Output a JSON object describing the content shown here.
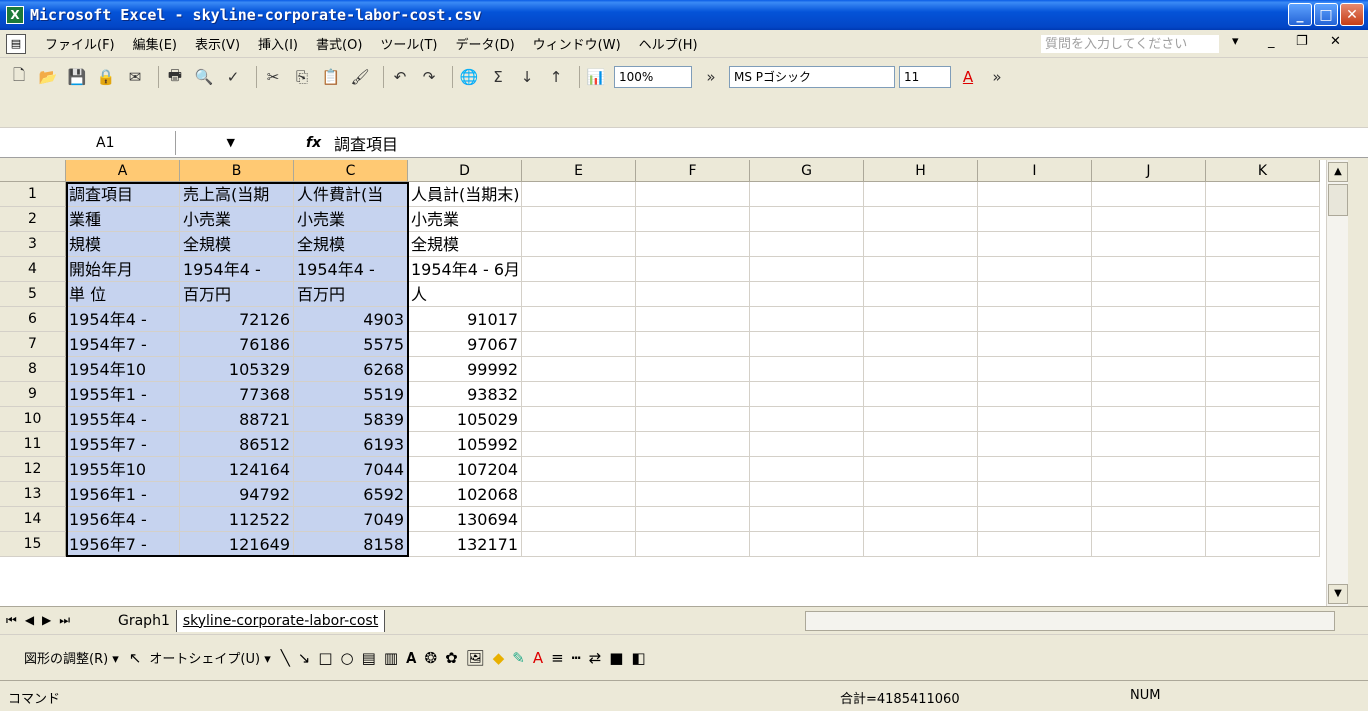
{
  "window": {
    "title": "Microsoft Excel - skyline-corporate-labor-cost.csv",
    "app_icon_glyph": "X"
  },
  "menu": {
    "items": [
      "ファイル(F)",
      "編集(E)",
      "表示(V)",
      "挿入(I)",
      "書式(O)",
      "ツール(T)",
      "データ(D)",
      "ウィンドウ(W)",
      "ヘルプ(H)"
    ],
    "help_placeholder": "質問を入力してください"
  },
  "toolbar": {
    "zoom": "100%",
    "font_name": "MS Pゴシック",
    "font_size": "11"
  },
  "formula_bar": {
    "name_box": "A1",
    "fx": "fx",
    "value": "調査項目"
  },
  "columns": [
    "A",
    "B",
    "C",
    "D",
    "E",
    "F",
    "G",
    "H",
    "I",
    "J",
    "K"
  ],
  "rows": [
    {
      "n": "1",
      "a": "調査項目",
      "b": "売上高(当期",
      "c": "人件費計(当",
      "d": "人員計(当期末)"
    },
    {
      "n": "2",
      "a": "業種",
      "b": "小売業",
      "c": "小売業",
      "d": "小売業"
    },
    {
      "n": "3",
      "a": "規模",
      "b": "全規模",
      "c": "全規模",
      "d": "全規模"
    },
    {
      "n": "4",
      "a": "開始年月",
      "b": "1954年4 -",
      "c": "1954年4 -",
      "d": "1954年4 - 6月"
    },
    {
      "n": "5",
      "a": "単 位",
      "b": "百万円",
      "c": "百万円",
      "d": "人"
    },
    {
      "n": "6",
      "a": "1954年4 -",
      "b": "72126",
      "c": "4903",
      "d": "91017"
    },
    {
      "n": "7",
      "a": "1954年7 -",
      "b": "76186",
      "c": "5575",
      "d": "97067"
    },
    {
      "n": "8",
      "a": "1954年10",
      "b": "105329",
      "c": "6268",
      "d": "99992"
    },
    {
      "n": "9",
      "a": "1955年1 -",
      "b": "77368",
      "c": "5519",
      "d": "93832"
    },
    {
      "n": "10",
      "a": "1955年4 -",
      "b": "88721",
      "c": "5839",
      "d": "105029"
    },
    {
      "n": "11",
      "a": "1955年7 -",
      "b": "86512",
      "c": "6193",
      "d": "105992"
    },
    {
      "n": "12",
      "a": "1955年10",
      "b": "124164",
      "c": "7044",
      "d": "107204"
    },
    {
      "n": "13",
      "a": "1956年1 -",
      "b": "94792",
      "c": "6592",
      "d": "102068"
    },
    {
      "n": "14",
      "a": "1956年4 -",
      "b": "112522",
      "c": "7049",
      "d": "130694"
    },
    {
      "n": "15",
      "a": "1956年7 -",
      "b": "121649",
      "c": "8158",
      "d": "132171"
    }
  ],
  "sheets": {
    "tab1": "Graph1",
    "tab2": "skyline-corporate-labor-cost"
  },
  "drawing": {
    "adjust": "図形の調整(R) ▾",
    "autoshape": "オートシェイプ(U) ▾"
  },
  "status": {
    "mode": "コマンド",
    "sum": "合計=4185411060",
    "num": "NUM"
  }
}
